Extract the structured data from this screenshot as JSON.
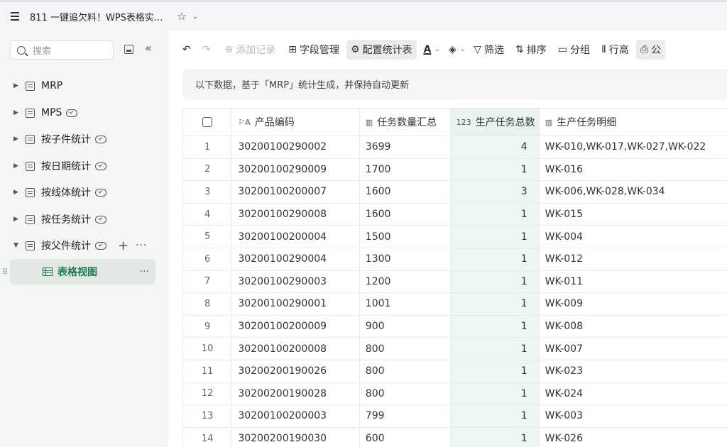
{
  "app": {
    "title": "811 一键追欠料！WPS表格实...",
    "star_icon": "star-icon",
    "menu_icon": "hamburger-icon"
  },
  "sidebar": {
    "search_placeholder": "搜索",
    "items": [
      {
        "label": "MRP",
        "cloud": false
      },
      {
        "label": "MPS",
        "cloud": true
      },
      {
        "label": "按子件统计",
        "cloud": true
      },
      {
        "label": "按日期统计",
        "cloud": true
      },
      {
        "label": "按线体统计",
        "cloud": true
      },
      {
        "label": "按任务统计",
        "cloud": true
      },
      {
        "label": "按父件统计",
        "cloud": true,
        "expanded": true
      }
    ],
    "active_view": "表格视图"
  },
  "toolbar": {
    "add_record": "添加记录",
    "field_manage": "字段管理",
    "config_stats": "配置统计表",
    "filter": "筛选",
    "sort": "排序",
    "group": "分组",
    "row_height": "行高",
    "truncated": "公"
  },
  "banner": "以下数据，基于「MRP」统计生成，并保持自动更新",
  "table": {
    "columns": [
      "产品编码",
      "任务数量汇总",
      "生产任务总数",
      "生产任务明细"
    ],
    "rows": [
      [
        "1",
        "30200100290002",
        "3699",
        "4",
        "WK-010,WK-017,WK-027,WK-022"
      ],
      [
        "2",
        "30200100290009",
        "1700",
        "1",
        "WK-016"
      ],
      [
        "3",
        "30200100200007",
        "1600",
        "3",
        "WK-006,WK-028,WK-034"
      ],
      [
        "4",
        "30200100290008",
        "1600",
        "1",
        "WK-015"
      ],
      [
        "5",
        "30200100200004",
        "1500",
        "1",
        "WK-004"
      ],
      [
        "6",
        "30200100290004",
        "1300",
        "1",
        "WK-012"
      ],
      [
        "7",
        "30200100290003",
        "1200",
        "1",
        "WK-011"
      ],
      [
        "8",
        "30200100290001",
        "1001",
        "1",
        "WK-009"
      ],
      [
        "9",
        "30200100200009",
        "900",
        "1",
        "WK-008"
      ],
      [
        "10",
        "30200100200008",
        "800",
        "1",
        "WK-007"
      ],
      [
        "11",
        "30200200190026",
        "800",
        "1",
        "WK-023"
      ],
      [
        "12",
        "30200200190028",
        "800",
        "1",
        "WK-024"
      ],
      [
        "13",
        "30200100200003",
        "799",
        "1",
        "WK-003"
      ],
      [
        "14",
        "30200200190030",
        "600",
        "1",
        "WK-026"
      ]
    ]
  }
}
